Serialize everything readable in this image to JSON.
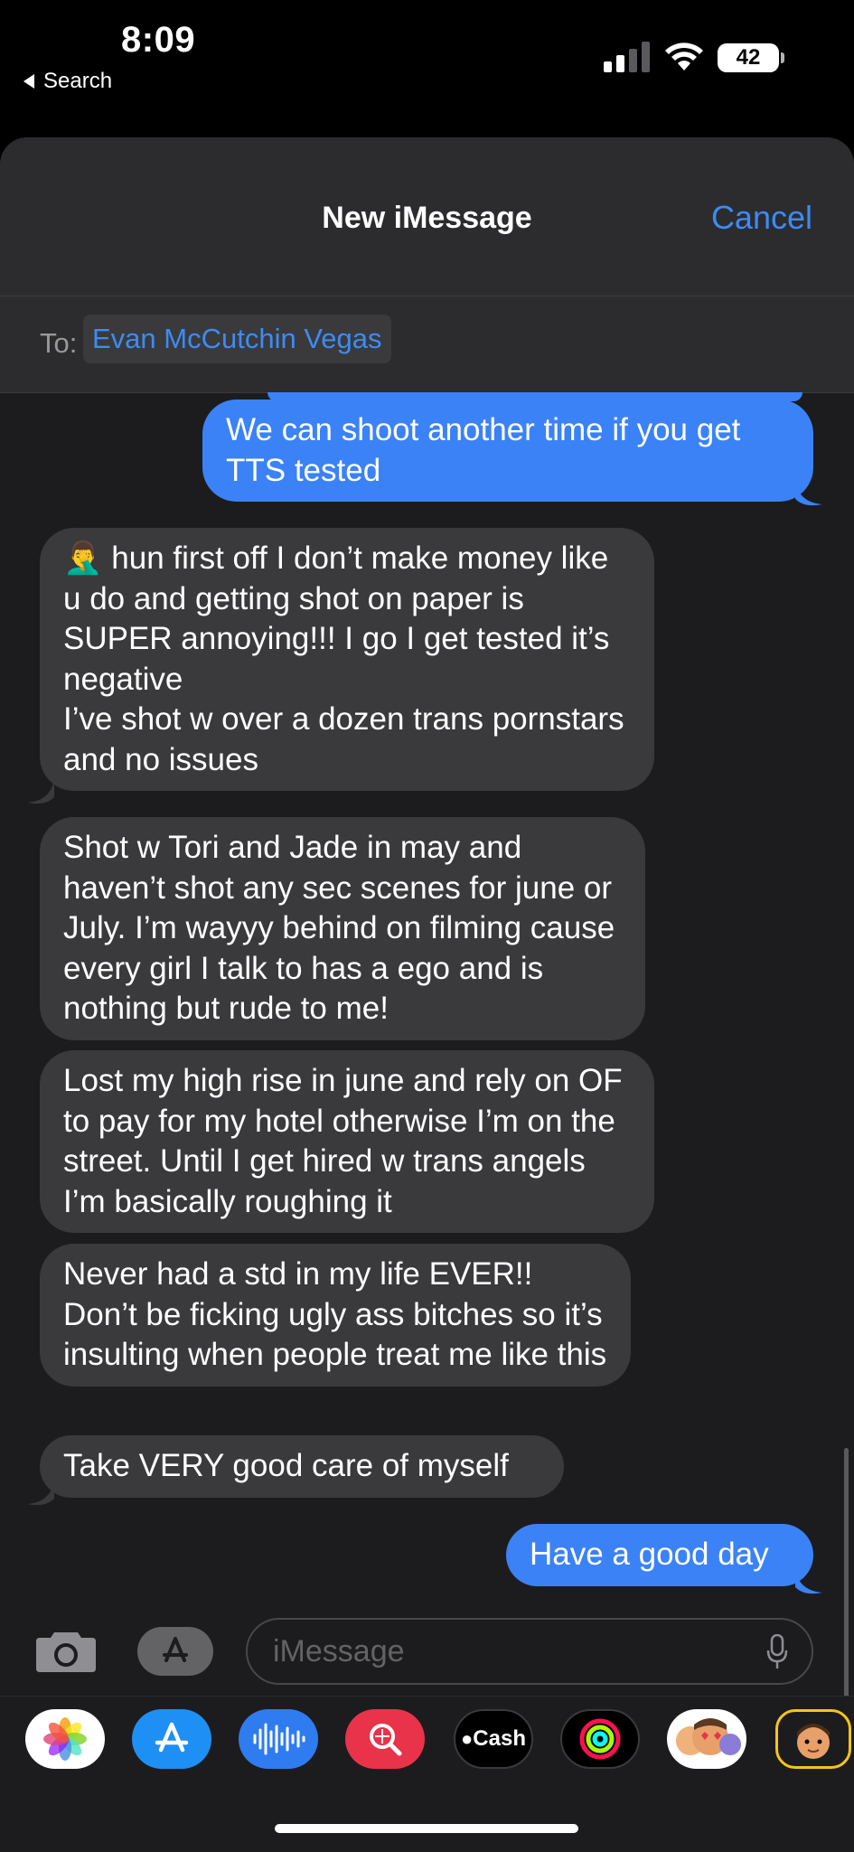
{
  "status_bar": {
    "time": "8:09",
    "back_label": "Search",
    "battery": "42"
  },
  "sheet": {
    "title": "New iMessage",
    "cancel_label": "Cancel",
    "to_label": "To:",
    "recipient": "Evan McCutchin Vegas"
  },
  "messages": [
    {
      "direction": "outgoing",
      "text": "We can shoot another time if you get TTS tested"
    },
    {
      "direction": "incoming",
      "text": "🤦‍♂️ hun first off I don’t make money like u do and getting shot on paper is SUPER annoying!!! I go I get tested it’s negative\nI’ve shot w over a dozen trans pornstars and no issues"
    },
    {
      "direction": "incoming",
      "text": "Shot w Tori and Jade in may and haven’t shot any sec scenes for june or July. I’m wayyy behind on filming cause every girl I talk to has a ego and is nothing but rude to me!"
    },
    {
      "direction": "incoming",
      "text": "Lost my high rise in june and rely on OF to pay for my hotel otherwise I’m on the street. Until I get hired w trans angels I’m basically roughing it"
    },
    {
      "direction": "incoming",
      "text": "Never had a std in my life EVER!! Don’t be ficking ugly ass bitches so it’s insulting when people treat me like this"
    },
    {
      "direction": "incoming",
      "text": "Take VERY good care of myself"
    },
    {
      "direction": "outgoing",
      "text": "Have a good day"
    }
  ],
  "composer": {
    "placeholder": "iMessage"
  },
  "app_drawer": [
    {
      "name": "photos-icon"
    },
    {
      "name": "app-store-icon"
    },
    {
      "name": "audio-message-icon"
    },
    {
      "name": "image-search-icon"
    },
    {
      "name": "apple-cash-icon",
      "label": "Cash"
    },
    {
      "name": "activity-icon"
    },
    {
      "name": "memoji-icon"
    },
    {
      "name": "memoji-stickers-icon"
    }
  ],
  "colors": {
    "accent": "#3b8cf5",
    "outgoing_bubble": "#3b82f6",
    "incoming_bubble": "#3a3a3c"
  }
}
